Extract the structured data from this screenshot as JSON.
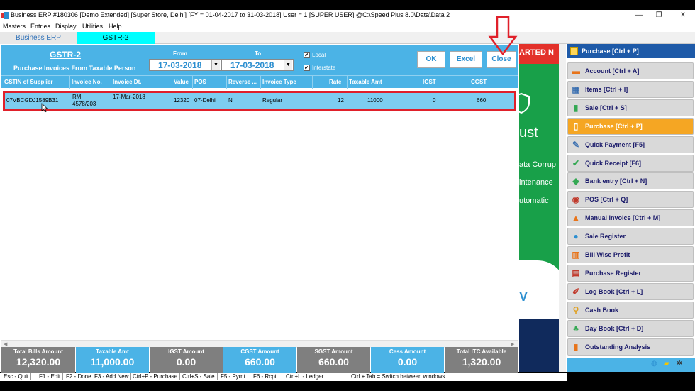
{
  "window": {
    "title": "Business ERP #180306  [Demo Extended]  [Super Store, Delhi] [FY = 01-04-2017 to 31-03-2018] User = 1 [SUPER USER]  @C:\\Speed Plus 8.0\\Data\\Data 2",
    "controls": [
      "—",
      "❐",
      "✕"
    ]
  },
  "menu": [
    "Masters",
    "Entries",
    "Display",
    "Utilities",
    "Help"
  ],
  "tabs": [
    "Business ERP",
    "GSTR-2"
  ],
  "gstr": {
    "title": "GSTR-2",
    "subtitle": "Purchase Invoices From Taxable Person",
    "from_label": "From",
    "to_label": "To",
    "from_date": "17-03-2018",
    "to_date": "17-03-2018",
    "local_label": "Local",
    "local_checked": true,
    "interstate_label": "Interstate",
    "interstate_checked": true,
    "ok_label": "OK",
    "excel_label": "Excel",
    "close_label": "Close"
  },
  "table": {
    "columns": [
      "GSTIN of Supplier",
      "Invoice No.",
      "Invoice Dt.",
      "Value",
      "POS",
      "Reverse ...",
      "Invoice Type",
      "Rate",
      "Taxable Amt",
      "IGST",
      "CGST"
    ],
    "rows": [
      {
        "gstin": "07VBCGDJ1589B31",
        "invoice_no_1": "RM",
        "invoice_no_2": "4578/203",
        "invoice_dt": "17-Mar-2018",
        "value": "12320",
        "pos": "07-Delhi",
        "reverse": "N",
        "invoice_type": "Regular",
        "rate": "12",
        "taxable_amt": "11000",
        "igst": "0",
        "cgst": "660"
      }
    ]
  },
  "totals": [
    {
      "label": "Total Bills Amount",
      "value": "12,320.00",
      "color": "#7f7f7f"
    },
    {
      "label": "Taxable Amt",
      "value": "11,000.00",
      "color": "#4bb3e6"
    },
    {
      "label": "IGST Amount",
      "value": "0.00",
      "color": "#7f7f7f"
    },
    {
      "label": "CGST Amount",
      "value": "660.00",
      "color": "#4bb3e6"
    },
    {
      "label": "SGST Amount",
      "value": "660.00",
      "color": "#7f7f7f"
    },
    {
      "label": "Cess Amount",
      "value": "0.00",
      "color": "#4bb3e6"
    },
    {
      "label": "Total ITC Available",
      "value": "1,320.00",
      "color": "#7f7f7f"
    }
  ],
  "statusbar": [
    "Esc - Quit",
    "F1 - Edit",
    "F2 - Done",
    "F3 - Add New",
    "Ctrl+P - Purchase",
    "Ctrl+S - Sale",
    "F5 - Pymt",
    "F6 - Rcpt",
    "Ctrl+L - Ledger",
    "Ctrl + Tab = Switch between windows"
  ],
  "background": {
    "banner": "ARTED N",
    "line1": "ust",
    "line2": "ata Corrup",
    "line3": "intenance",
    "line4": "utomatic",
    "letter": "V"
  },
  "sidebar": {
    "header": "Purchase [Ctrl + P]",
    "items": [
      {
        "label": "Account [Ctrl + A]",
        "icon": "account-icon",
        "glyph": "▬",
        "color": "#e8741a"
      },
      {
        "label": "Items [Ctrl + I]",
        "icon": "items-icon",
        "glyph": "▦",
        "color": "#3a6fb0"
      },
      {
        "label": "Sale [Ctrl + S]",
        "icon": "sale-icon",
        "glyph": "▮",
        "color": "#34a853"
      },
      {
        "label": "Purchase [Ctrl + P]",
        "icon": "purchase-icon",
        "glyph": "▯",
        "color": "#ffffff",
        "active": true
      },
      {
        "label": "Quick Payment [F5]",
        "icon": "quick-payment-icon",
        "glyph": "✎",
        "color": "#3a6fb0"
      },
      {
        "label": "Quick Receipt [F6]",
        "icon": "quick-receipt-icon",
        "glyph": "✔",
        "color": "#34a853"
      },
      {
        "label": "Bank entry [Ctrl + N]",
        "icon": "bank-entry-icon",
        "glyph": "◆",
        "color": "#34a853"
      },
      {
        "label": "POS [Ctrl + Q]",
        "icon": "pos-icon",
        "glyph": "◉",
        "color": "#c0392b"
      },
      {
        "label": "Manual Invoice [Ctrl + M]",
        "icon": "manual-invoice-icon",
        "glyph": "▲",
        "color": "#e8741a"
      },
      {
        "label": "Sale Register",
        "icon": "sale-register-icon",
        "glyph": "●",
        "color": "#2c8fd0"
      },
      {
        "label": "Bill Wise Profit",
        "icon": "bill-wise-profit-icon",
        "glyph": "▥",
        "color": "#e8741a"
      },
      {
        "label": "Purchase Register",
        "icon": "purchase-register-icon",
        "glyph": "▤",
        "color": "#c0392b"
      },
      {
        "label": "Log Book [Ctrl + L]",
        "icon": "log-book-icon",
        "glyph": "✐",
        "color": "#c0392b"
      },
      {
        "label": "Cash Book",
        "icon": "cash-book-icon",
        "glyph": "⚲",
        "color": "#e0a020"
      },
      {
        "label": "Day Book [Ctrl + D]",
        "icon": "day-book-icon",
        "glyph": "♣",
        "color": "#34a853"
      },
      {
        "label": "Outstanding Analysis",
        "icon": "outstanding-analysis-icon",
        "glyph": "▮",
        "color": "#e8741a"
      }
    ]
  }
}
